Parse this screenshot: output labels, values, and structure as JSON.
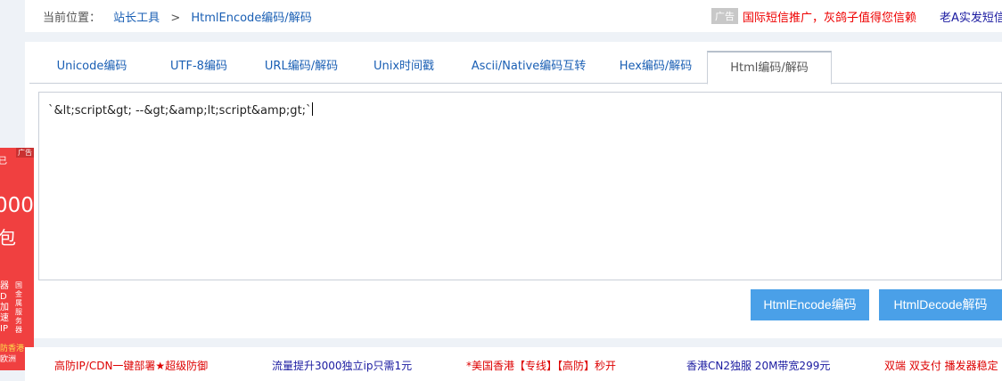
{
  "breadcrumb": {
    "label": "当前位置：",
    "home": "站长工具",
    "separator": ">",
    "current": "HtmlEncode编码/解码"
  },
  "top_ads": {
    "tag": "广告",
    "text1": "国际短信推广，灰鸽子值得您信赖",
    "text2": "老A实发短信"
  },
  "tabs": [
    {
      "label": "Unicode编码"
    },
    {
      "label": "UTF-8编码"
    },
    {
      "label": "URL编码/解码"
    },
    {
      "label": "Unix时间戳"
    },
    {
      "label": "Ascii/Native编码互转"
    },
    {
      "label": "Hex编码/解码"
    },
    {
      "label": "Html编码/解码"
    }
  ],
  "active_tab": "Html编码/解码",
  "editor": {
    "value": "`&lt;script&gt; --&gt;&amp;lt;script&amp;gt;`"
  },
  "buttons": {
    "encode": "HtmlEncode编码",
    "decode": "HtmlDecode解码"
  },
  "left_ad": {
    "badge": "广告",
    "top": "已",
    "big": "000",
    "bag": "包",
    "side1": "器\nD\n加\n速\nIP",
    "side2": "国\n金\n属\n服\n务\n器",
    "yellow": "防香港",
    "bottom": "欧洲"
  },
  "bottom_ads": [
    {
      "text": "高防IP/CDN一键部署★超级防御",
      "color": "red"
    },
    {
      "text": "流量提升3000独立ip只需1元",
      "color": "blue"
    },
    {
      "text": "*美国香港【专线】【高防】秒开",
      "color": "red"
    },
    {
      "text": "香港CN2独服 20M带宽299元",
      "color": "blue"
    },
    {
      "text": "双端 双支付 播发器稳定",
      "color": "red"
    }
  ],
  "colors": {
    "accent": "#4aa0e8",
    "link": "#1a5fb4",
    "ad_red": "#f04040"
  }
}
